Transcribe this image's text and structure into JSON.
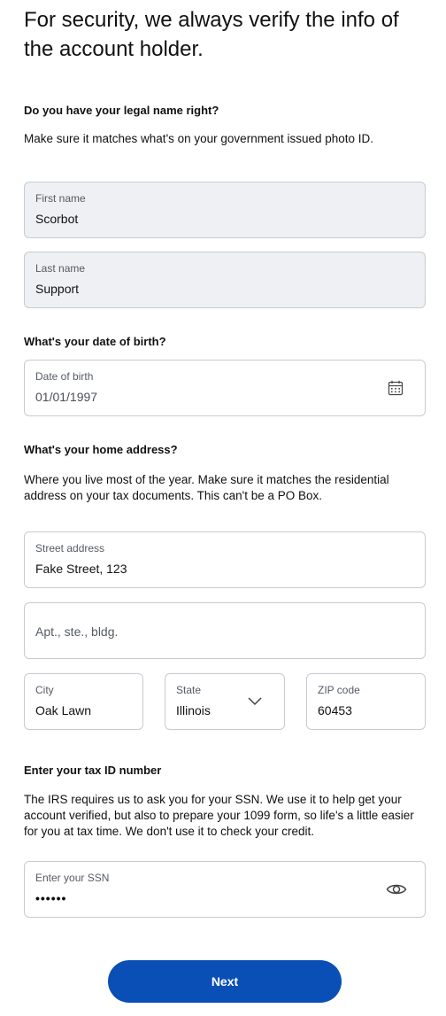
{
  "title": "For security, we always verify the info of the account holder.",
  "name_section": {
    "heading": "Do you have your legal name right?",
    "description": "Make sure it matches what's on your government issued photo ID.",
    "first_name": {
      "label": "First name",
      "value": "Scorbot"
    },
    "last_name": {
      "label": "Last name",
      "value": "Support"
    }
  },
  "dob_section": {
    "heading": "What's your date of birth?",
    "field": {
      "label": "Date of birth",
      "value": "01/01/1997",
      "icon": "calendar-icon"
    }
  },
  "address_section": {
    "heading": "What's your home address?",
    "description": "Where you live most of the year. Make sure it matches the residential address on your tax documents. This can't be a PO Box.",
    "street": {
      "label": "Street address",
      "value": "Fake Street, 123"
    },
    "apt": {
      "placeholder": "Apt., ste., bldg."
    },
    "city": {
      "label": "City",
      "value": "Oak Lawn"
    },
    "state": {
      "label": "State",
      "value": "Illinois",
      "icon": "chevron-down-icon"
    },
    "zip": {
      "label": "ZIP code",
      "value": "60453"
    }
  },
  "tax_section": {
    "heading": "Enter your tax ID number",
    "description": "The IRS requires us to ask you for your SSN. We use it to help get your account verified, but also to prepare your 1099 form, so life's a little easier for you at tax time. We don't use it to check your credit.",
    "ssn": {
      "label": "Enter your SSN",
      "value": "••••••",
      "icon": "eye-icon"
    }
  },
  "next_button": {
    "label": "Next",
    "color": "#0a4fb6"
  }
}
